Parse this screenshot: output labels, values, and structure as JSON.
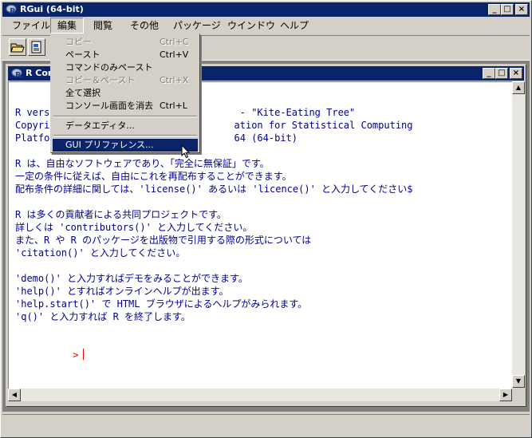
{
  "app": {
    "title": "RGui (64-bit)"
  },
  "menubar": [
    "ファイル",
    "編集",
    "閲覧",
    "その他",
    "パッケージ",
    "ウインドウ",
    "ヘルプ"
  ],
  "child": {
    "title": "R Console"
  },
  "edit_menu": {
    "items": [
      {
        "label": "コピー",
        "accel": "Ctrl+C",
        "disabled": true
      },
      {
        "label": "ペースト",
        "accel": "Ctrl+V",
        "disabled": false
      },
      {
        "label": "コマンドのみペースト",
        "accel": "",
        "disabled": false
      },
      {
        "label": "コピー＆ペースト",
        "accel": "Ctrl+X",
        "disabled": true
      },
      {
        "label": "全て選択",
        "accel": "",
        "disabled": false
      },
      {
        "label": "コンソール画面を消去",
        "accel": "Ctrl+L",
        "disabled": false
      },
      {
        "label": "データエディタ...",
        "accel": "",
        "disabled": false
      },
      {
        "label": "GUI プリファレンス...",
        "accel": "",
        "disabled": false,
        "selected": true
      }
    ]
  },
  "console": {
    "lines": [
      "R version                              - \"Kite-Eating Tree\"",
      "Copyri                                ation for Statistical Computing",
      "Platfo                                64 (64-bit)",
      "",
      "R は、自由なソフトウェアであり、「完全に無保証」です。",
      "一定の条件に従えば、自由にこれを再配布することができます。",
      "配布条件の詳細に関しては、'license()' あるいは 'licence()' と入力してください$",
      "",
      "R は多くの貢献者による共同プロジェクトです。",
      "詳しくは 'contributors()' と入力してください。",
      "また、R や R のパッケージを出版物で引用する際の形式については",
      "'citation()' と入力してください。",
      "",
      "'demo()' と入力すればデモをみることができます。",
      "'help()' とすればオンラインヘルプが出ます。",
      "'help.start()' で HTML ブラウザによるヘルプがみられます。",
      "'q()' と入力すれば R を終了します。"
    ],
    "prompt": ">"
  }
}
